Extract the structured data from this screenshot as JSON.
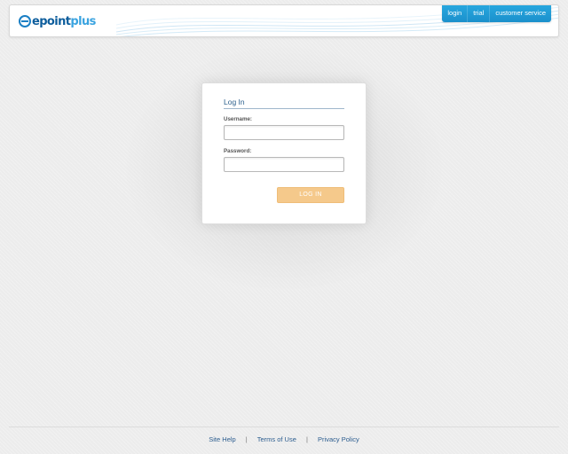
{
  "header": {
    "logo_text_main": "epoint",
    "logo_text_accent": "plus",
    "nav": [
      {
        "label": "login"
      },
      {
        "label": "trial"
      },
      {
        "label": "customer service"
      }
    ]
  },
  "login_card": {
    "title": "Log In",
    "username_label": "Username:",
    "username_value": "",
    "password_label": "Password:",
    "password_value": "",
    "submit_label": "LOG IN"
  },
  "footer": {
    "links": [
      {
        "label": "Site Help"
      },
      {
        "label": "Terms of Use"
      },
      {
        "label": "Privacy Policy"
      }
    ],
    "separator": "|"
  },
  "colors": {
    "brand_blue": "#1b7fc4",
    "nav_blue": "#1b90cc",
    "button_orange": "#f5c98b",
    "link_blue": "#2c5d8f"
  }
}
